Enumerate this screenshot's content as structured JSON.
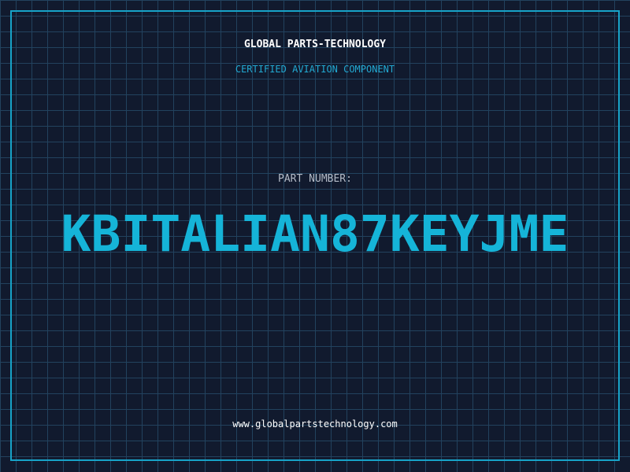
{
  "header": {
    "brand": "GLOBAL PARTS-TECHNOLOGY",
    "subtitle": "CERTIFIED AVIATION COMPONENT"
  },
  "part": {
    "label": "PART NUMBER:",
    "number": "KBITALIAN87KEYJME"
  },
  "footer": {
    "url": "www.globalpartstechnology.com"
  },
  "colors": {
    "background": "#111a2e",
    "grid": "#22425e",
    "accent": "#15b4d8",
    "frame": "#17a3c8"
  }
}
